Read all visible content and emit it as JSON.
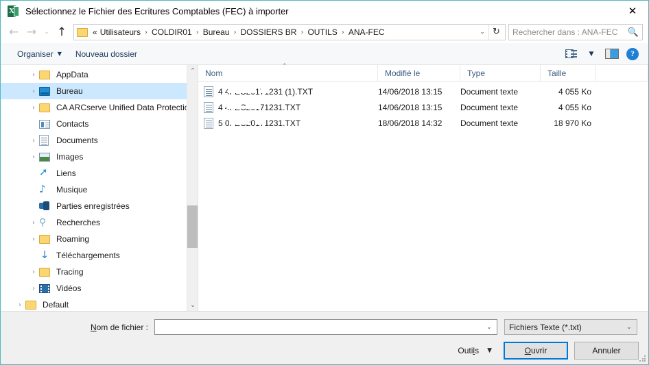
{
  "window": {
    "title": "Sélectionnez le Fichier des Ecritures Comptables (FEC) à importer",
    "app_icon": "excel-icon",
    "close_label": "✕",
    "border_color": "#4fb8bd"
  },
  "nav": {
    "back": "←",
    "forward": "→",
    "history": "⌄",
    "up": "↑",
    "refresh": "↻",
    "dropdown": "⌄",
    "breadcrumbs": [
      "«",
      "Utilisateurs",
      "COLDIR01",
      "Bureau",
      "DOSSIERS BR",
      "OUTILS",
      "ANA-FEC"
    ],
    "separator": "›"
  },
  "search": {
    "placeholder": "Rechercher dans : ANA-FEC",
    "icon": "search-icon"
  },
  "toolbar": {
    "organize_label": "Organiser",
    "new_folder_label": "Nouveau dossier",
    "caret": "▼",
    "view_icon": "view-options-icon",
    "view_caret": "▼",
    "preview_icon": "preview-pane-icon",
    "help_icon": "?"
  },
  "sidebar": {
    "items": [
      {
        "label": "AppData",
        "icon": "folder-icon",
        "expandable": true,
        "indent": 1,
        "selected": false
      },
      {
        "label": "Bureau",
        "icon": "desktop-icon",
        "expandable": true,
        "indent": 1,
        "selected": true
      },
      {
        "label": "CA ARCserve Unified Data Protectio",
        "icon": "folder-icon",
        "expandable": true,
        "indent": 1,
        "selected": false
      },
      {
        "label": "Contacts",
        "icon": "contacts-icon",
        "expandable": false,
        "indent": 1,
        "selected": false
      },
      {
        "label": "Documents",
        "icon": "documents-icon",
        "expandable": true,
        "indent": 1,
        "selected": false
      },
      {
        "label": "Images",
        "icon": "pictures-icon",
        "expandable": true,
        "indent": 1,
        "selected": false
      },
      {
        "label": "Liens",
        "icon": "links-icon",
        "expandable": false,
        "indent": 1,
        "selected": false
      },
      {
        "label": "Musique",
        "icon": "music-icon",
        "expandable": false,
        "indent": 1,
        "selected": false
      },
      {
        "label": "Parties enregistrées",
        "icon": "saved-games-icon",
        "expandable": false,
        "indent": 1,
        "selected": false
      },
      {
        "label": "Recherches",
        "icon": "searches-icon",
        "expandable": true,
        "indent": 1,
        "selected": false
      },
      {
        "label": "Roaming",
        "icon": "folder-icon",
        "expandable": true,
        "indent": 1,
        "selected": false
      },
      {
        "label": "Téléchargements",
        "icon": "downloads-icon",
        "expandable": false,
        "indent": 1,
        "selected": false
      },
      {
        "label": "Tracing",
        "icon": "folder-icon",
        "expandable": true,
        "indent": 1,
        "selected": false
      },
      {
        "label": "Vidéos",
        "icon": "videos-icon",
        "expandable": true,
        "indent": 1,
        "selected": false
      },
      {
        "label": "Default",
        "icon": "folder-icon",
        "expandable": true,
        "indent": 0,
        "selected": false
      }
    ],
    "expand_glyph": "›",
    "scroll_up": "⌃",
    "scroll_down": "⌄",
    "selection_color": "#cce8ff"
  },
  "filelist": {
    "columns": [
      {
        "label": "Nom",
        "sorted": "asc"
      },
      {
        "label": "Modifié le",
        "sorted": ""
      },
      {
        "label": "Type",
        "sorted": ""
      },
      {
        "label": "Taille",
        "sorted": ""
      }
    ],
    "sort_caret": "⌃",
    "rows": [
      {
        "name": "4            4FEC20171231 (1).TXT",
        "modified": "14/06/2018 13:15",
        "type": "Document texte",
        "size": "4 055 Ko",
        "icon": "text-file-icon"
      },
      {
        "name": "4        4FEC20171231.TXT",
        "modified": "14/06/2018 13:15",
        "type": "Document texte",
        "size": "4 055 Ko",
        "icon": "text-file-icon"
      },
      {
        "name": "5            0FEC20171231.TXT",
        "modified": "18/06/2018 14:32",
        "type": "Document texte",
        "size": "18 970 Ko",
        "icon": "text-file-icon"
      }
    ]
  },
  "footer": {
    "filename_label_prefix": "N",
    "filename_label_rest": "om de fichier :",
    "filename_value": "",
    "filetype_value": "Fichiers Texte (*.txt)",
    "combo_caret": "⌄",
    "tools_prefix": "Outi",
    "tools_accel": "l",
    "tools_suffix": "s",
    "tools_caret": "▼",
    "open_accel": "O",
    "open_rest": "uvrir",
    "cancel_label": "Annuler",
    "accent_color": "#0078d7"
  }
}
